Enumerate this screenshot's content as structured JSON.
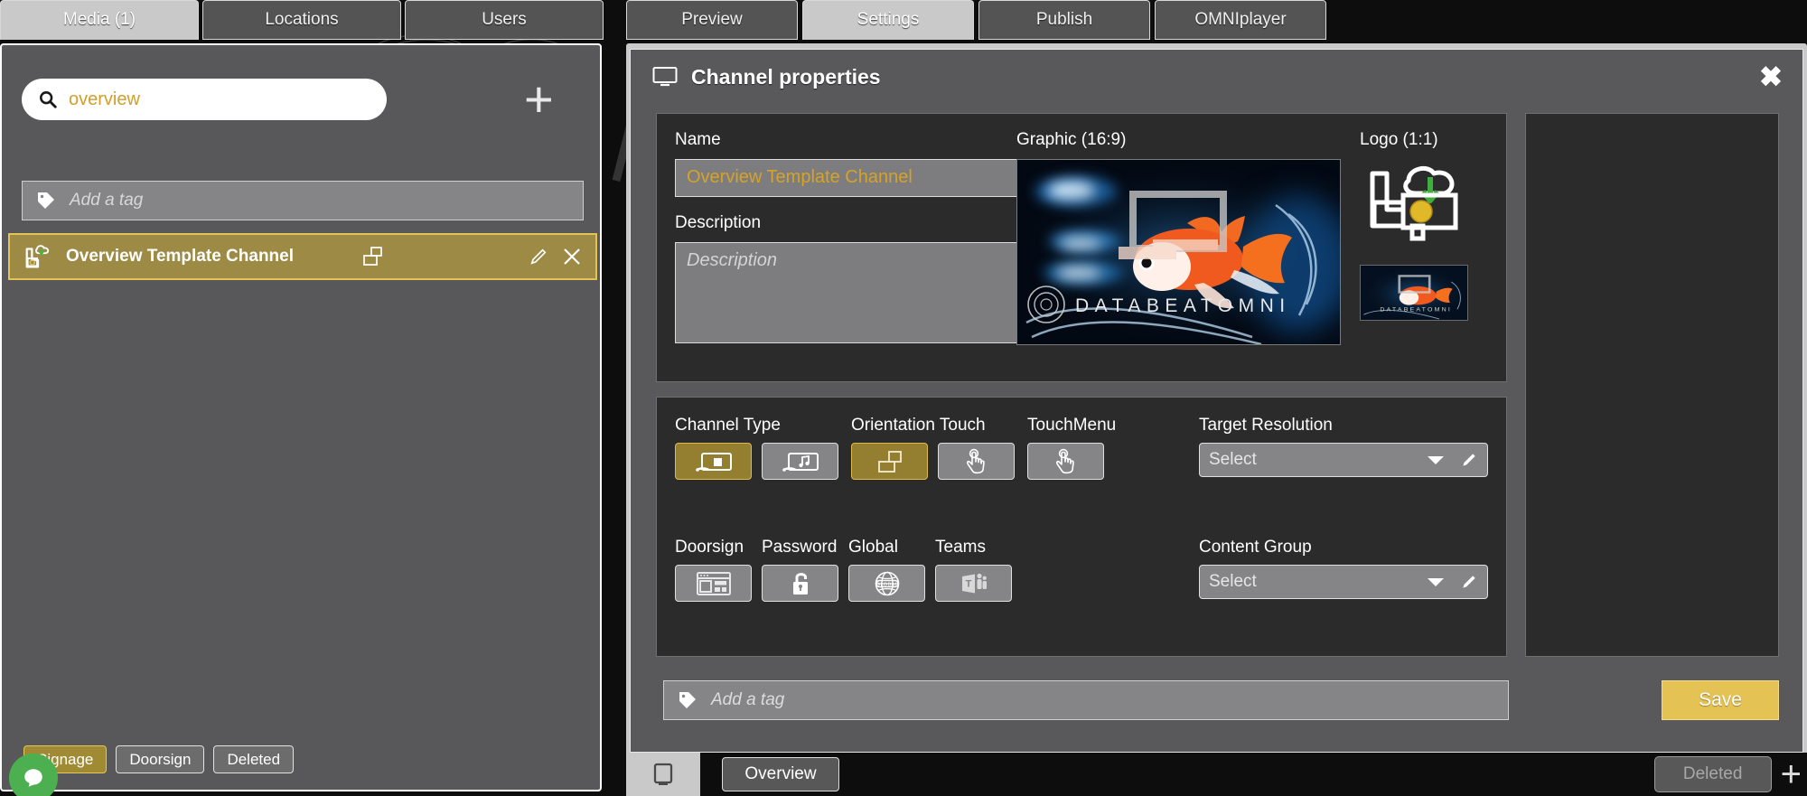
{
  "left_panel": {
    "tabs": [
      {
        "label": "Media (1)",
        "active": true
      },
      {
        "label": "Locations",
        "active": false
      },
      {
        "label": "Users",
        "active": false
      }
    ],
    "search": {
      "value": "overview",
      "icon": "search-icon"
    },
    "add_button_label": "+",
    "tag_input": {
      "placeholder": "Add a tag",
      "icon": "tag-icon"
    },
    "channel_item": {
      "name": "Overview Template Channel",
      "left_icon": "cloud-upload-screen-icon",
      "orientation_icon": "orientation-landscape-icon",
      "edit_icon": "pencil-icon",
      "close_icon": "close-icon"
    },
    "footer_filters": [
      {
        "label": "Signage",
        "active": true
      },
      {
        "label": "Doorsign",
        "active": false
      },
      {
        "label": "Deleted",
        "active": false
      }
    ]
  },
  "right_panel": {
    "tabs": [
      {
        "label": "Preview",
        "active": false
      },
      {
        "label": "Settings",
        "active": true
      },
      {
        "label": "Publish",
        "active": false
      },
      {
        "label": "OMNIplayer",
        "active": false
      }
    ],
    "dialog": {
      "title": "Channel properties",
      "title_icon": "monitor-icon",
      "close_icon": "close-icon",
      "name": {
        "label": "Name",
        "value": "Overview Template Channel"
      },
      "description": {
        "label": "Description",
        "placeholder": "Description",
        "value": ""
      },
      "graphic": {
        "label": "Graphic (16:9)",
        "caption": "DATABEATOMNI"
      },
      "logo": {
        "label": "Logo (1:1)",
        "icon": "signage-cloud-download-icon",
        "thumb_caption": "DATABEATOMNI"
      },
      "groups": [
        {
          "label": "Channel Type",
          "buttons": [
            {
              "icon": "cast-screen-icon",
              "selected": true
            },
            {
              "icon": "cast-music-icon",
              "selected": false
            }
          ]
        },
        {
          "label": "Orientation Touch",
          "buttons": [
            {
              "icon": "orientation-landscape-icon",
              "selected": true
            },
            {
              "icon": "touch-hand-icon",
              "selected": false
            }
          ]
        },
        {
          "label": "TouchMenu",
          "buttons": [
            {
              "icon": "touch-hand-icon",
              "selected": false
            }
          ]
        }
      ],
      "groups2": [
        {
          "label": "Doorsign",
          "icon": "doorsign-layout-icon",
          "selected": false
        },
        {
          "label": "Password",
          "icon": "unlock-icon",
          "selected": false
        },
        {
          "label": "Global",
          "icon": "globe-icon",
          "selected": false
        },
        {
          "label": "Teams",
          "icon": "microsoft-teams-icon",
          "selected": false
        }
      ],
      "target_resolution": {
        "label": "Target Resolution",
        "value": "Select",
        "chevron": "chevron-down-icon",
        "edit_icon": "pencil-icon"
      },
      "content_group": {
        "label": "Content Group",
        "value": "Select",
        "chevron": "chevron-down-icon",
        "edit_icon": "pencil-icon"
      },
      "footer": {
        "tag_placeholder": "Add a tag",
        "tag_icon": "tag-icon",
        "save_label": "Save"
      }
    }
  },
  "bottom_bar": {
    "monitor_icon": "monitor-icon",
    "overview_label": "Overview",
    "deleted_label": "Deleted",
    "plus_label": "+"
  },
  "colors": {
    "accent_gold": "#d6a326",
    "save_button": "#e4c354",
    "selected_tile": "#937f2f",
    "panel_bg": "#59585a",
    "card_bg": "#2b2b2b"
  }
}
